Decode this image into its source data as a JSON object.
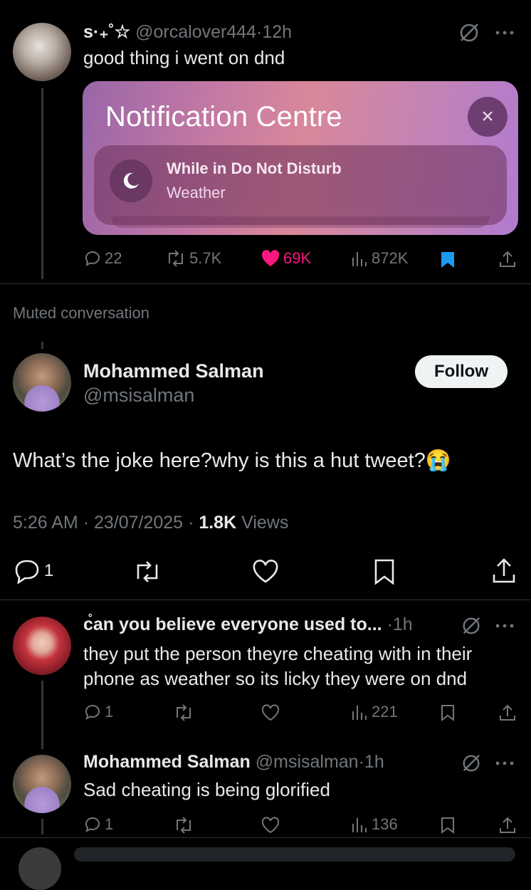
{
  "post1": {
    "display_name": "s·₊˚☆",
    "handle": "@orcalover444",
    "time": "12h",
    "text": "good thing i went on dnd",
    "stats": {
      "replies": "22",
      "reposts": "5.7K",
      "likes": "69K",
      "views": "872K"
    }
  },
  "notification_card": {
    "title": "Notification Centre",
    "close_glyph": "×",
    "line1": "While in Do Not Disturb",
    "line2": "Weather"
  },
  "muted_label": "Muted conversation",
  "main_post": {
    "display_name": "Mohammed Salman",
    "handle": "@msisalman",
    "follow_label": "Follow",
    "text": "What’s the joke here?why is this a hut tweet?😭",
    "time": "5:26 AM",
    "date": "23/07/2025",
    "views_count": "1.8K",
    "views_label": "Views",
    "reply_count": "1"
  },
  "reply1": {
    "display_name": "c̊an you believe everyone used to...",
    "time": "1h",
    "text_line1": "they put the person theyre cheating with in their",
    "text_line2": "phone as weather so its licky they were on dnd",
    "stats": {
      "replies": "1",
      "views": "221"
    }
  },
  "reply2": {
    "display_name": "Mohammed Salman",
    "handle": "@msisalman",
    "time": "1h",
    "text": "Sad cheating is being glorified",
    "stats": {
      "replies": "1",
      "views": "136"
    }
  },
  "separator": "·",
  "colors": {
    "like": "#f91880",
    "bookmark": "#1d9bf0",
    "muted": "#71767b"
  },
  "icons": [
    "reply-icon",
    "repost-icon",
    "like-icon",
    "views-icon",
    "bookmark-icon",
    "share-icon",
    "grok-icon",
    "more-icon",
    "moon-icon"
  ]
}
